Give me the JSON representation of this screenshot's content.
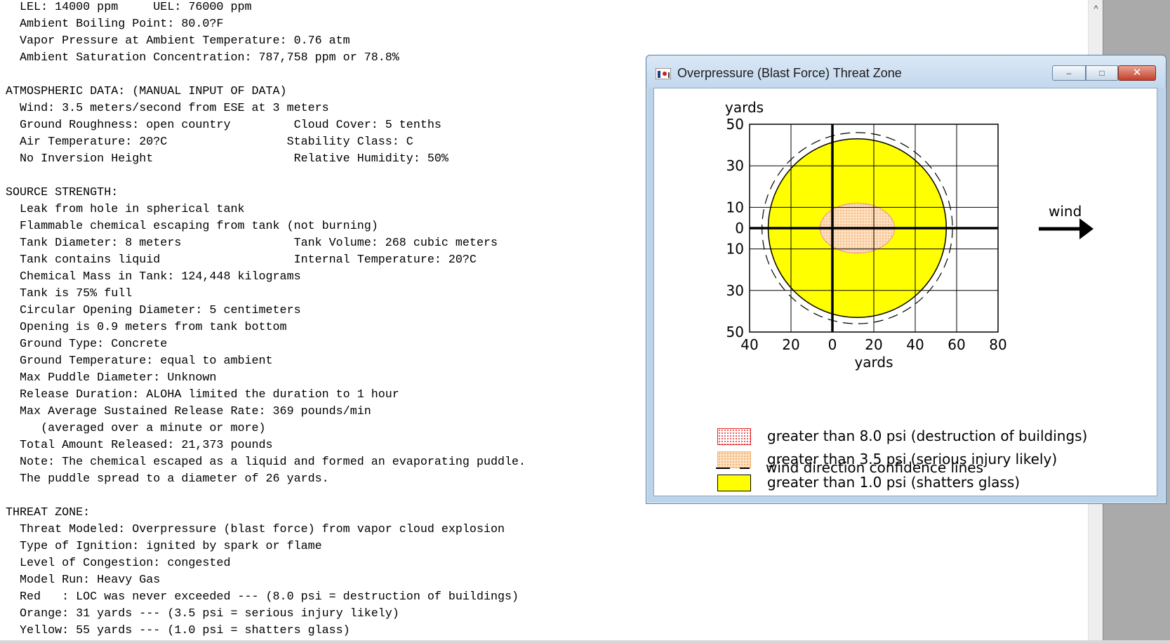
{
  "report": {
    "lines": [
      "  LEL: 14000 ppm     UEL: 76000 ppm",
      "  Ambient Boiling Point: 80.0?F",
      "  Vapor Pressure at Ambient Temperature: 0.76 atm",
      "  Ambient Saturation Concentration: 787,758 ppm or 78.8%",
      "",
      "ATMOSPHERIC DATA: (MANUAL INPUT OF DATA)",
      "  Wind: 3.5 meters/second from ESE at 3 meters",
      "  Ground Roughness: open country         Cloud Cover: 5 tenths",
      "  Air Temperature: 20?C                 Stability Class: C",
      "  No Inversion Height                    Relative Humidity: 50%",
      "",
      "SOURCE STRENGTH:",
      "  Leak from hole in spherical tank",
      "  Flammable chemical escaping from tank (not burning)",
      "  Tank Diameter: 8 meters                Tank Volume: 268 cubic meters",
      "  Tank contains liquid                   Internal Temperature: 20?C",
      "  Chemical Mass in Tank: 124,448 kilograms",
      "  Tank is 75% full",
      "  Circular Opening Diameter: 5 centimeters",
      "  Opening is 0.9 meters from tank bottom",
      "  Ground Type: Concrete",
      "  Ground Temperature: equal to ambient",
      "  Max Puddle Diameter: Unknown",
      "  Release Duration: ALOHA limited the duration to 1 hour",
      "  Max Average Sustained Release Rate: 369 pounds/min",
      "     (averaged over a minute or more)",
      "  Total Amount Released: 21,373 pounds",
      "  Note: The chemical escaped as a liquid and formed an evaporating puddle.",
      "  The puddle spread to a diameter of 26 yards.",
      "",
      "THREAT ZONE:",
      "  Threat Modeled: Overpressure (blast force) from vapor cloud explosion",
      "  Type of Ignition: ignited by spark or flame",
      "  Level of Congestion: congested",
      "  Model Run: Heavy Gas",
      "  Red   : LOC was never exceeded --- (8.0 psi = destruction of buildings)",
      "  Orange: 31 yards --- (3.5 psi = serious injury likely)",
      "  Yellow: 55 yards --- (1.0 psi = shatters glass)"
    ]
  },
  "scrollbar": {
    "up_arrow": "^"
  },
  "window": {
    "title": "Overpressure (Blast Force) Threat Zone",
    "minimize_glyph": "–",
    "maximize_glyph": "□",
    "close_glyph": "✕",
    "legend": [
      {
        "label": "greater than 8.0 psi (destruction of buildings)"
      },
      {
        "label": "greater than 3.5 psi (serious injury likely)"
      },
      {
        "label": "greater than 1.0 psi (shatters glass)"
      },
      {
        "label": "wind direction confidence lines"
      }
    ]
  },
  "colors": {
    "red_zone": "#e32626",
    "orange_zone": "#fde0c0",
    "yellow_zone": "#ffff00",
    "titlebar": "#c3d8ee"
  },
  "chart_data": {
    "type": "area",
    "xlabel": "yards",
    "ylabel": "yards",
    "xlim": [
      -40,
      80
    ],
    "ylim": [
      -50,
      50
    ],
    "x_ticks": [
      -40,
      -20,
      0,
      20,
      40,
      60,
      80
    ],
    "x_tick_labels": [
      "40",
      "20",
      "0",
      "20",
      "40",
      "60",
      "80"
    ],
    "y_ticks": [
      50,
      30,
      10,
      0,
      -10,
      -30,
      -50
    ],
    "y_tick_labels": [
      "50",
      "30",
      "10",
      "0",
      "10",
      "30",
      "50"
    ],
    "grid": true,
    "wind_label": "wind",
    "wind_direction": "toward +x",
    "zones": [
      {
        "name": "yellow",
        "center_x": 12,
        "center_y": 0,
        "radius_x": 43,
        "radius_y": 43
      },
      {
        "name": "orange",
        "center_x": 12,
        "center_y": 0,
        "radius_x": 18,
        "radius_y": 12
      }
    ],
    "confidence_lines": {
      "center_x": 12,
      "center_y": 0,
      "radius": 46
    }
  }
}
